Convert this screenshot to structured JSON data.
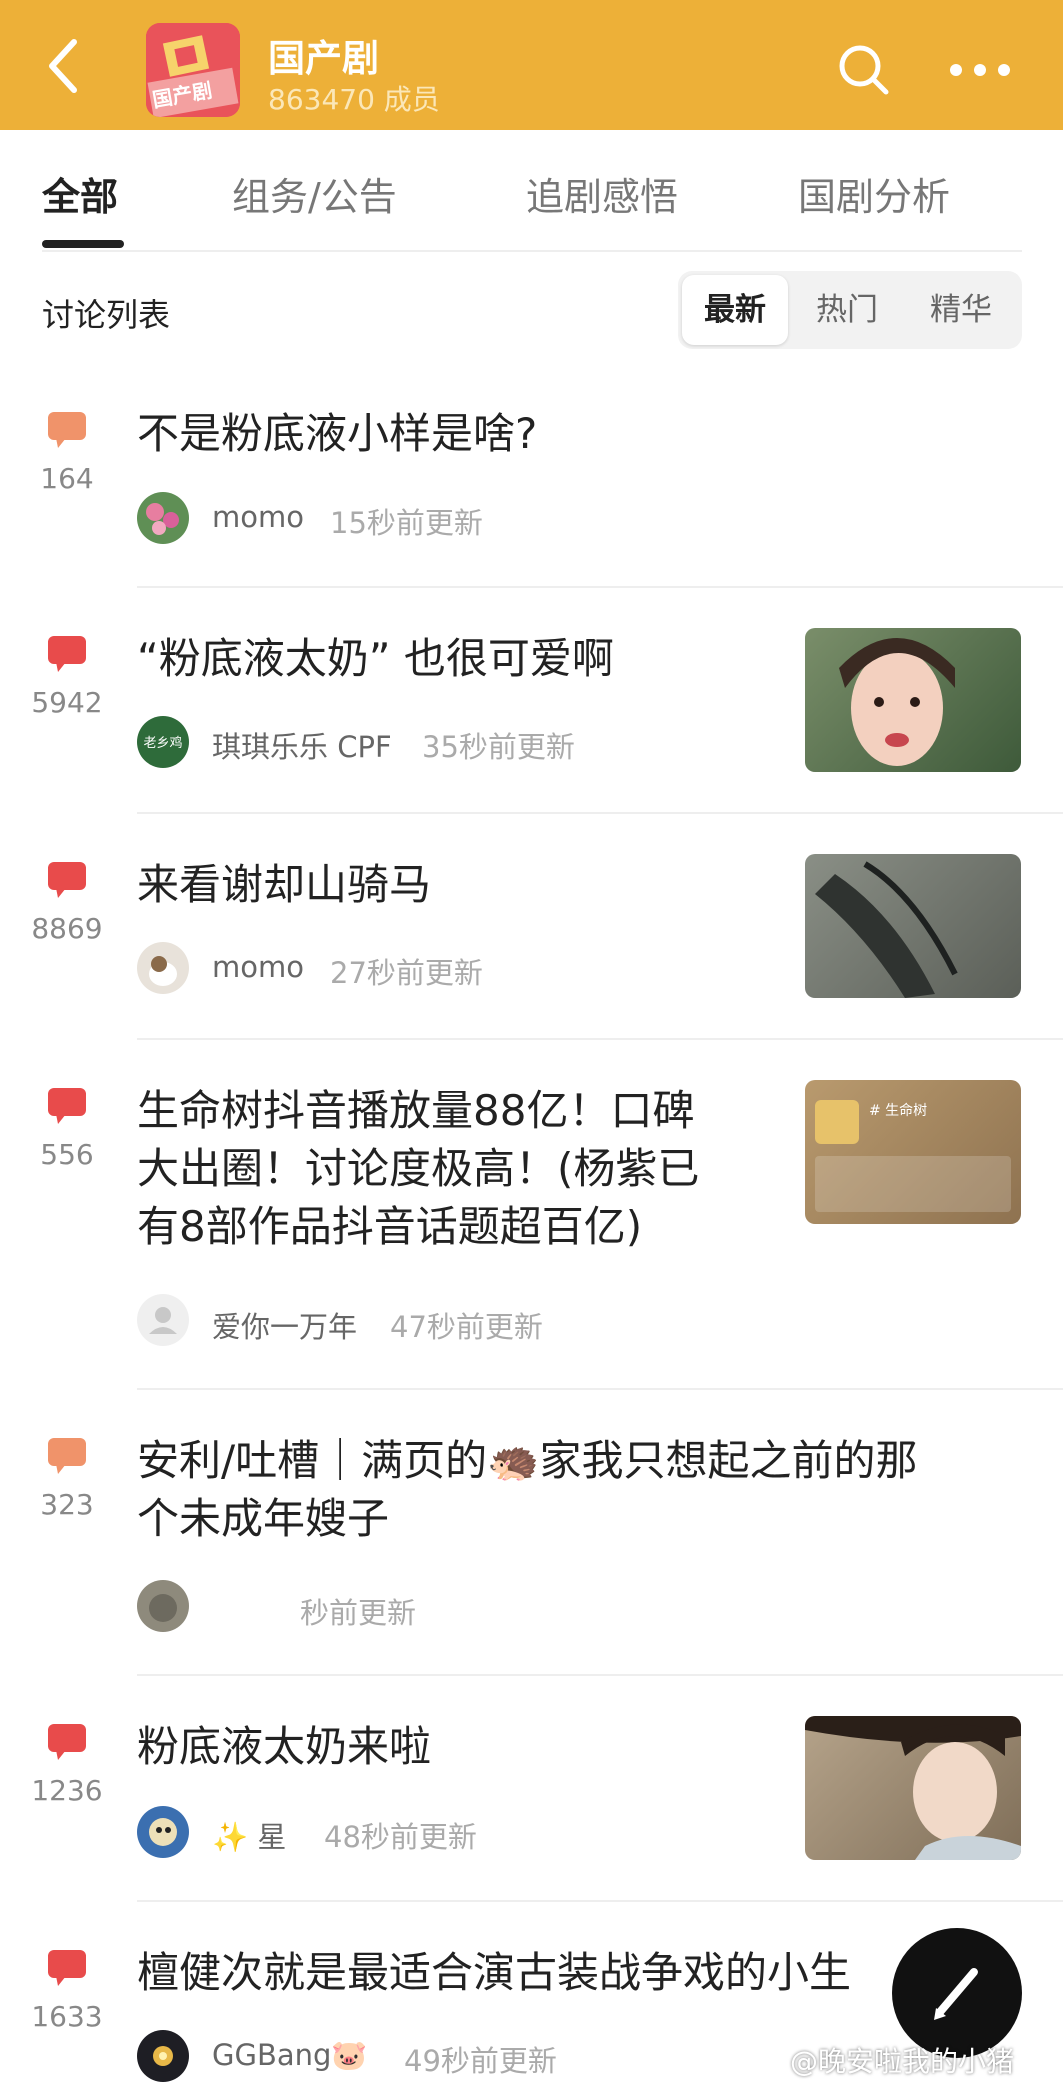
{
  "header": {
    "group_name": "国产剧",
    "member_count": "863470 成员",
    "logo_text": "国产剧",
    "background_color": "#EDB038"
  },
  "tabs": [
    {
      "label": "全部",
      "active": true
    },
    {
      "label": "组务/公告",
      "active": false
    },
    {
      "label": "追剧感悟",
      "active": false
    },
    {
      "label": "国剧分析",
      "active": false
    }
  ],
  "list_label": "讨论列表",
  "sort_options": [
    {
      "label": "最新",
      "active": true
    },
    {
      "label": "热门",
      "active": false
    },
    {
      "label": "精华",
      "active": false
    }
  ],
  "posts": [
    {
      "count": "164",
      "title_lines": [
        "不是粉底液小样是啥?"
      ],
      "author": "momo",
      "time": "15秒前更新",
      "bubble_color": "#F0936A",
      "has_thumb": false,
      "avatar_icon": "flower-avatar"
    },
    {
      "count": "5942",
      "title_lines": [
        "“粉底液太奶” 也很可爱啊"
      ],
      "author": "琪琪乐乐 CPF",
      "time": "35秒前更新",
      "bubble_color": "#E84B4B",
      "has_thumb": true,
      "avatar_text": "老乡鸡",
      "avatar_icon": "laoxiangji-avatar"
    },
    {
      "count": "8869",
      "title_lines": [
        "来看谢却山骑马"
      ],
      "author": "momo",
      "time": "27秒前更新",
      "bubble_color": "#E84B4B",
      "has_thumb": true,
      "avatar_icon": "pet-avatar"
    },
    {
      "count": "556",
      "title_lines": [
        "生命树抖音播放量88亿！口碑",
        "大出圈！讨论度极高！(杨紫已",
        "有8部作品抖音话题超百亿)"
      ],
      "author": "爱你一万年",
      "time": "47秒前更新",
      "bubble_color": "#E84B4B",
      "has_thumb": true,
      "thumb_text": "# 生命树",
      "avatar_icon": "default-user-avatar"
    },
    {
      "count": "323",
      "title_lines": [
        "安利/吐槽｜满页的🦔家我只想起之前的那",
        "个未成年嫂子"
      ],
      "author": "",
      "time": "秒前更新",
      "bubble_color": "#F0936A",
      "has_thumb": false,
      "avatar_icon": "cat-avatar"
    },
    {
      "count": "1236",
      "title_lines": [
        "粉底液太奶来啦"
      ],
      "author": "✨ 星",
      "time": "48秒前更新",
      "bubble_color": "#E84B4B",
      "has_thumb": true,
      "avatar_icon": "cartoon-avatar"
    },
    {
      "count": "1633",
      "title_lines": [
        "檀健次就是最适合演古装战争戏的小生"
      ],
      "author": "GGBang🐷",
      "time": "49秒前更新",
      "bubble_color": "#E84B4B",
      "has_thumb": false,
      "avatar_icon": "firework-avatar"
    }
  ],
  "watermark": "@晚安啦我的小猪"
}
